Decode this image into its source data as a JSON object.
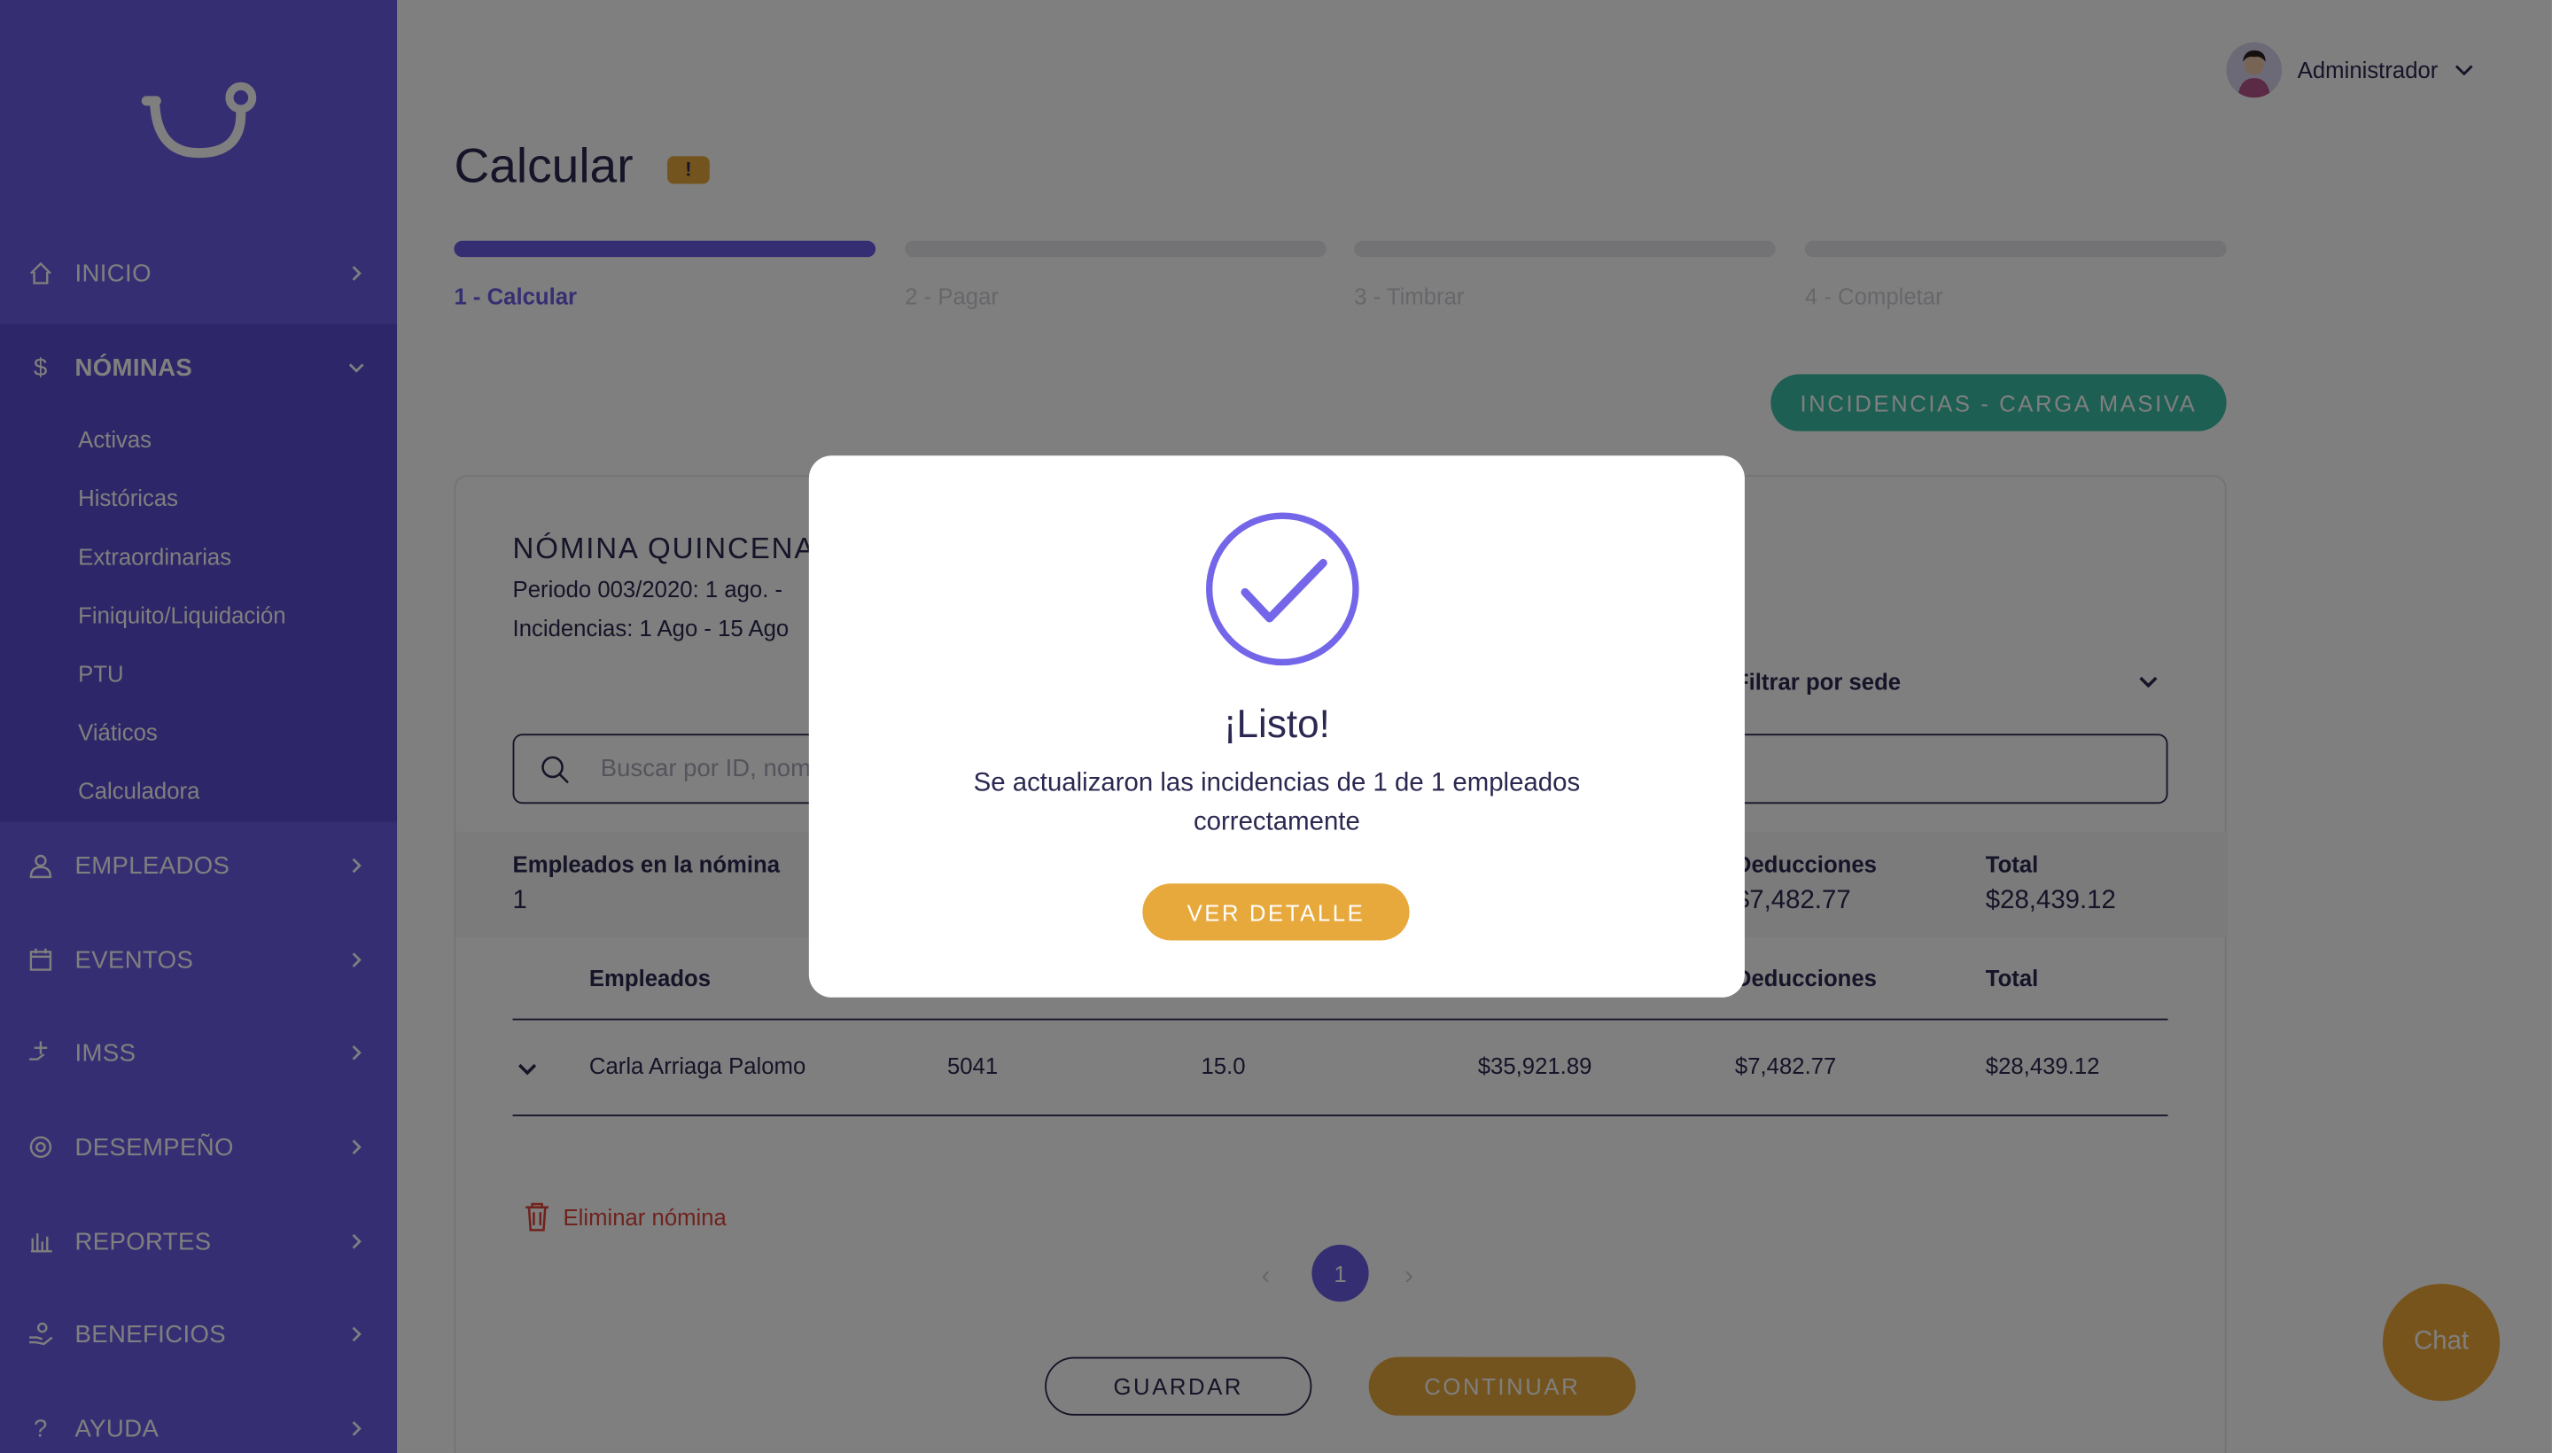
{
  "colors": {
    "primary": "#6a5ce6",
    "accent": "#e8a93c",
    "teal": "#3bbfa6",
    "danger": "#e0453a",
    "text": "#2a2850"
  },
  "sidebar": {
    "items": [
      {
        "label": "INICIO",
        "icon": "home-icon"
      },
      {
        "label": "NÓMINAS",
        "icon": "dollar-icon"
      },
      {
        "label": "EMPLEADOS",
        "icon": "user-icon"
      },
      {
        "label": "EVENTOS",
        "icon": "calendar-icon"
      },
      {
        "label": "IMSS",
        "icon": "medical-icon"
      },
      {
        "label": "DESEMPEÑO",
        "icon": "target-icon"
      },
      {
        "label": "REPORTES",
        "icon": "bar-chart-icon"
      },
      {
        "label": "BENEFICIOS",
        "icon": "gift-hand-icon"
      },
      {
        "label": "AYUDA",
        "icon": "question-icon"
      }
    ],
    "sub_items": [
      "Activas",
      "Históricas",
      "Extraordinarias",
      "Finiquito/Liquidación",
      "PTU",
      "Viáticos",
      "Calculadora"
    ]
  },
  "header": {
    "user_name": "Administrador"
  },
  "page": {
    "title": "Calcular",
    "warning_badge": "!"
  },
  "steps": [
    "1 - Calcular",
    "2 - Pagar",
    "3 - Timbrar",
    "4 - Completar"
  ],
  "actions": {
    "incidencias_label": "INCIDENCIAS - CARGA MASIVA"
  },
  "card": {
    "title": "NÓMINA QUINCENAL",
    "periodo": "Periodo 003/2020: 1 ago. -",
    "incidencias": "Incidencias: 1 Ago - 15 Ago",
    "filter_label": "Filtrar por sede",
    "search_placeholder": "Buscar por ID, nombre",
    "summary": {
      "empleados_label": "Empleados en la nómina",
      "empleados_value": "1",
      "deducciones_label": "Deducciones",
      "deducciones_value": "$7,482.77",
      "total_label": "Total",
      "total_value": "$28,439.12"
    },
    "table": {
      "headers": {
        "empleados": "Empleados",
        "deducciones": "Deducciones",
        "total": "Total"
      },
      "row": {
        "name": "Carla Arriaga Palomo",
        "id": "5041",
        "days": "15.0",
        "percepciones": "$35,921.89",
        "deducciones": "$7,482.77",
        "total": "$28,439.12"
      }
    },
    "delete_label": "Eliminar nómina",
    "pagination": {
      "current": "1",
      "prev": "‹",
      "next": "›"
    },
    "save_label": "GUARDAR",
    "continue_label": "CONTINUAR"
  },
  "modal": {
    "title": "¡Listo!",
    "message": "Se actualizaron las incidencias de 1 de 1 empleados correctamente",
    "button_label": "VER DETALLE"
  },
  "chat_label": "Chat"
}
